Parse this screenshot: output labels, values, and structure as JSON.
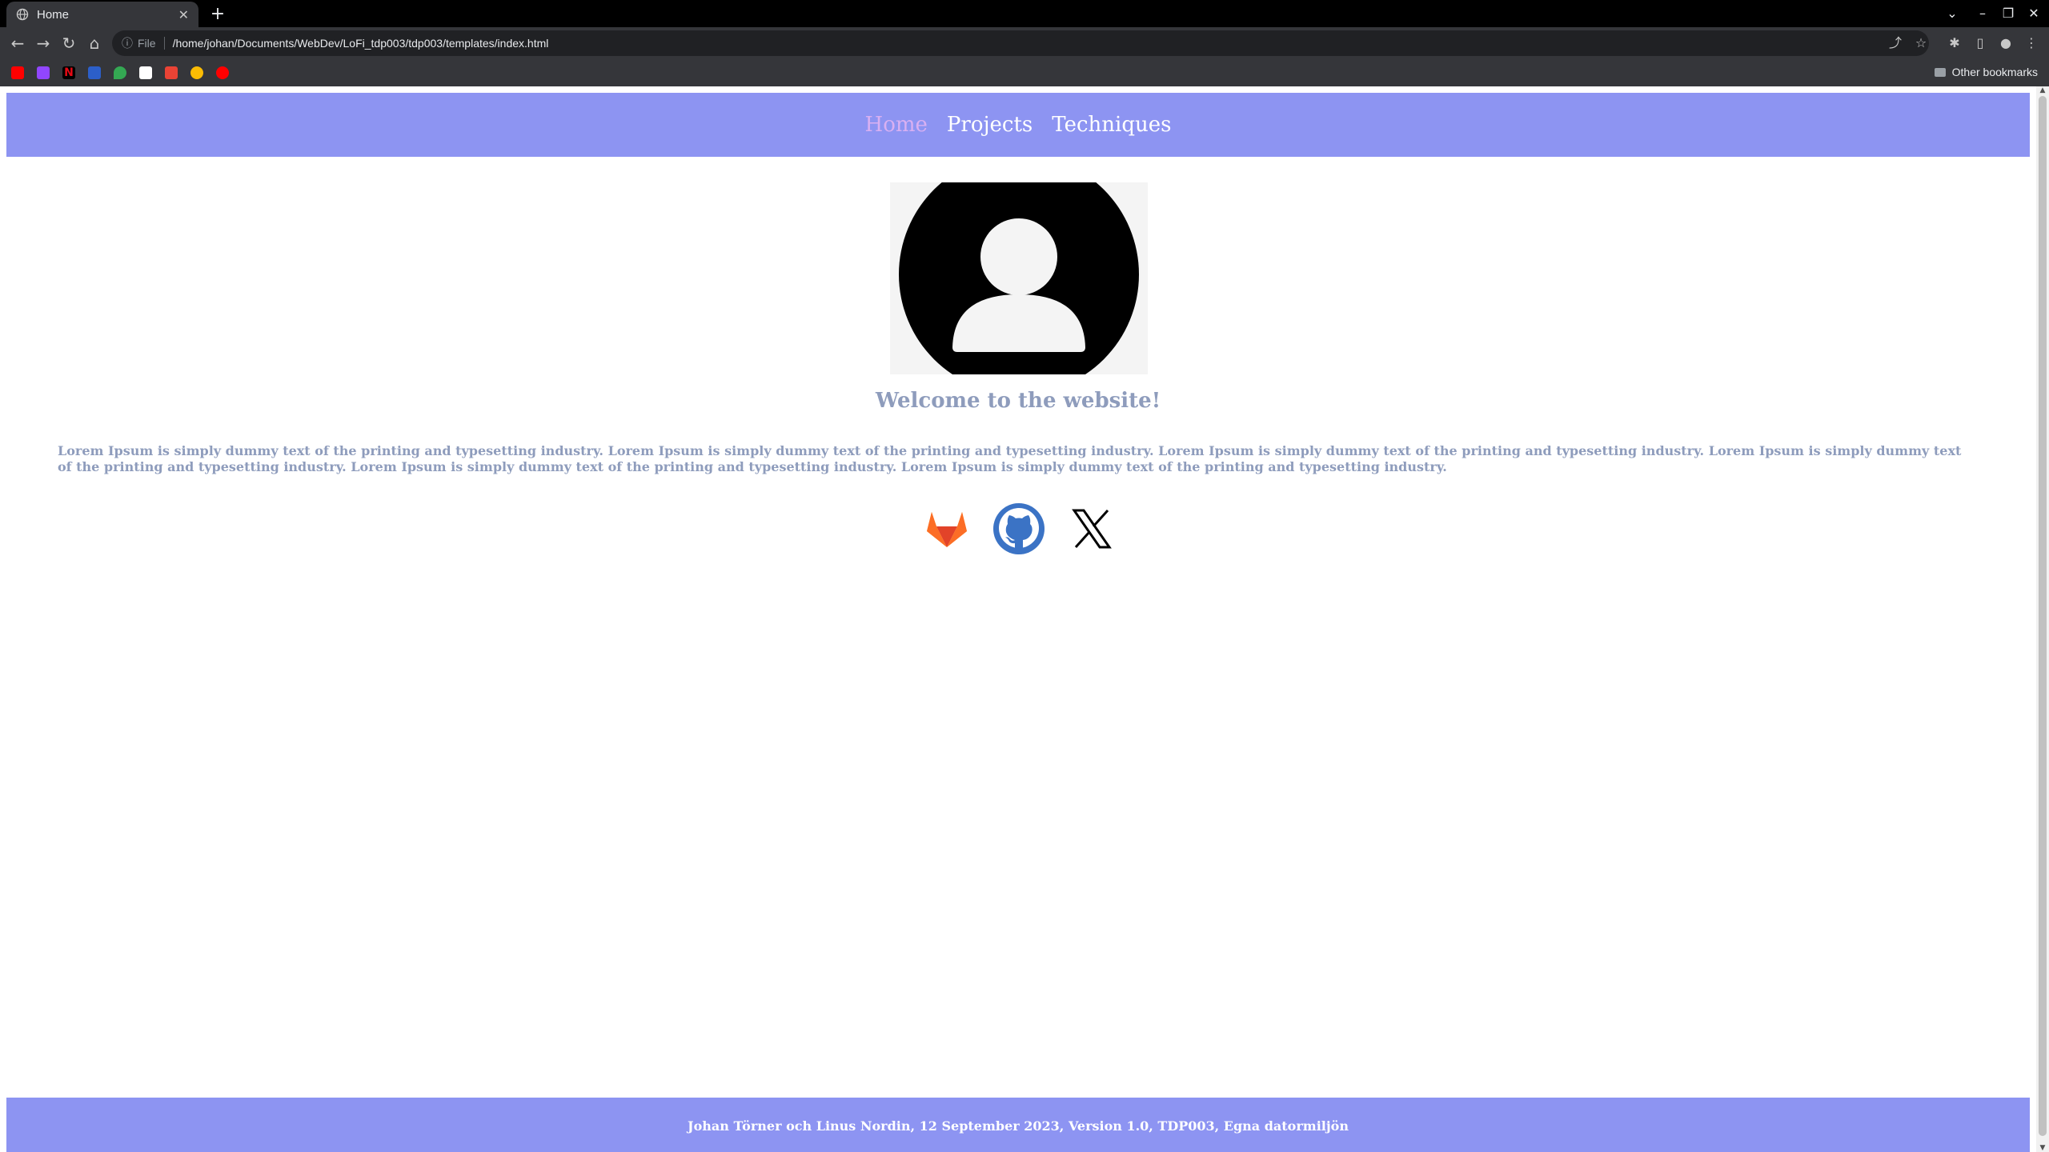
{
  "browser": {
    "tab_title": "Home",
    "new_tab": "+",
    "address_scheme": "File",
    "address_url": "/home/johan/Documents/WebDev/LoFi_tdp003/tdp003/templates/index.html",
    "other_bookmarks": "Other bookmarks",
    "bookmark_icons": [
      "youtube-icon",
      "twitch-icon",
      "netflix-icon",
      "bookmark-icon",
      "maps-icon",
      "amazon-icon",
      "gmail-icon",
      "drive-icon",
      "youtube-music-icon"
    ]
  },
  "nav": {
    "home": "Home",
    "projects": "Projects",
    "techniques": "Techniques"
  },
  "main": {
    "welcome": "Welcome to the website!",
    "lorem": "Lorem Ipsum is simply dummy text of the printing and typesetting industry. Lorem Ipsum is simply dummy text of the printing and typesetting industry. Lorem Ipsum is simply dummy text of the printing and typesetting industry. Lorem Ipsum is simply dummy text of the printing and typesetting industry. Lorem Ipsum is simply dummy text of the printing and typesetting industry. Lorem Ipsum is simply dummy text of the printing and typesetting industry."
  },
  "socials": [
    "gitlab-icon",
    "github-icon",
    "x-icon"
  ],
  "footer": {
    "text": "Johan Törner och Linus Nordin, 12 September 2023, Version 1.0, TDP003, Egna datormiljön"
  },
  "colors": {
    "header_bg": "#8d94f2",
    "nav_active": "#d9b0f2",
    "body_text": "#8e9cbc"
  }
}
